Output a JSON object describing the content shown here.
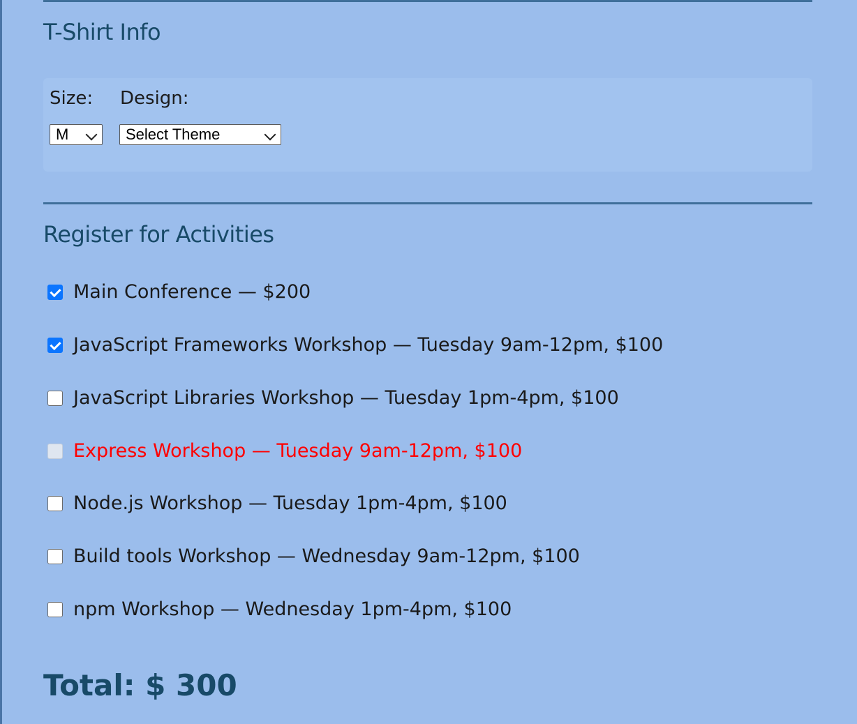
{
  "tshirt": {
    "title": "T-Shirt Info",
    "size_label": "Size:",
    "size_value": "M",
    "design_label": "Design:",
    "design_value": "Select Theme"
  },
  "activities": {
    "title": "Register for Activities",
    "items": [
      {
        "label": "Main Conference — $200",
        "checked": true,
        "disabled": false
      },
      {
        "label": "JavaScript Frameworks Workshop — Tuesday 9am-12pm, $100",
        "checked": true,
        "disabled": false
      },
      {
        "label": "JavaScript Libraries Workshop — Tuesday 1pm-4pm, $100",
        "checked": false,
        "disabled": false
      },
      {
        "label": "Express Workshop — Tuesday 9am-12pm, $100",
        "checked": false,
        "disabled": true
      },
      {
        "label": "Node.js Workshop — Tuesday 1pm-4pm, $100",
        "checked": false,
        "disabled": false
      },
      {
        "label": "Build tools Workshop — Wednesday 9am-12pm, $100",
        "checked": false,
        "disabled": false
      },
      {
        "label": "npm Workshop — Wednesday 1pm-4pm, $100",
        "checked": false,
        "disabled": false
      }
    ]
  },
  "total": {
    "text": "Total: $ 300"
  },
  "colors": {
    "background": "#9bbdec",
    "heading": "#184a68",
    "disabled_text": "#ff0000",
    "checkbox_checked": "#0b75ff"
  }
}
